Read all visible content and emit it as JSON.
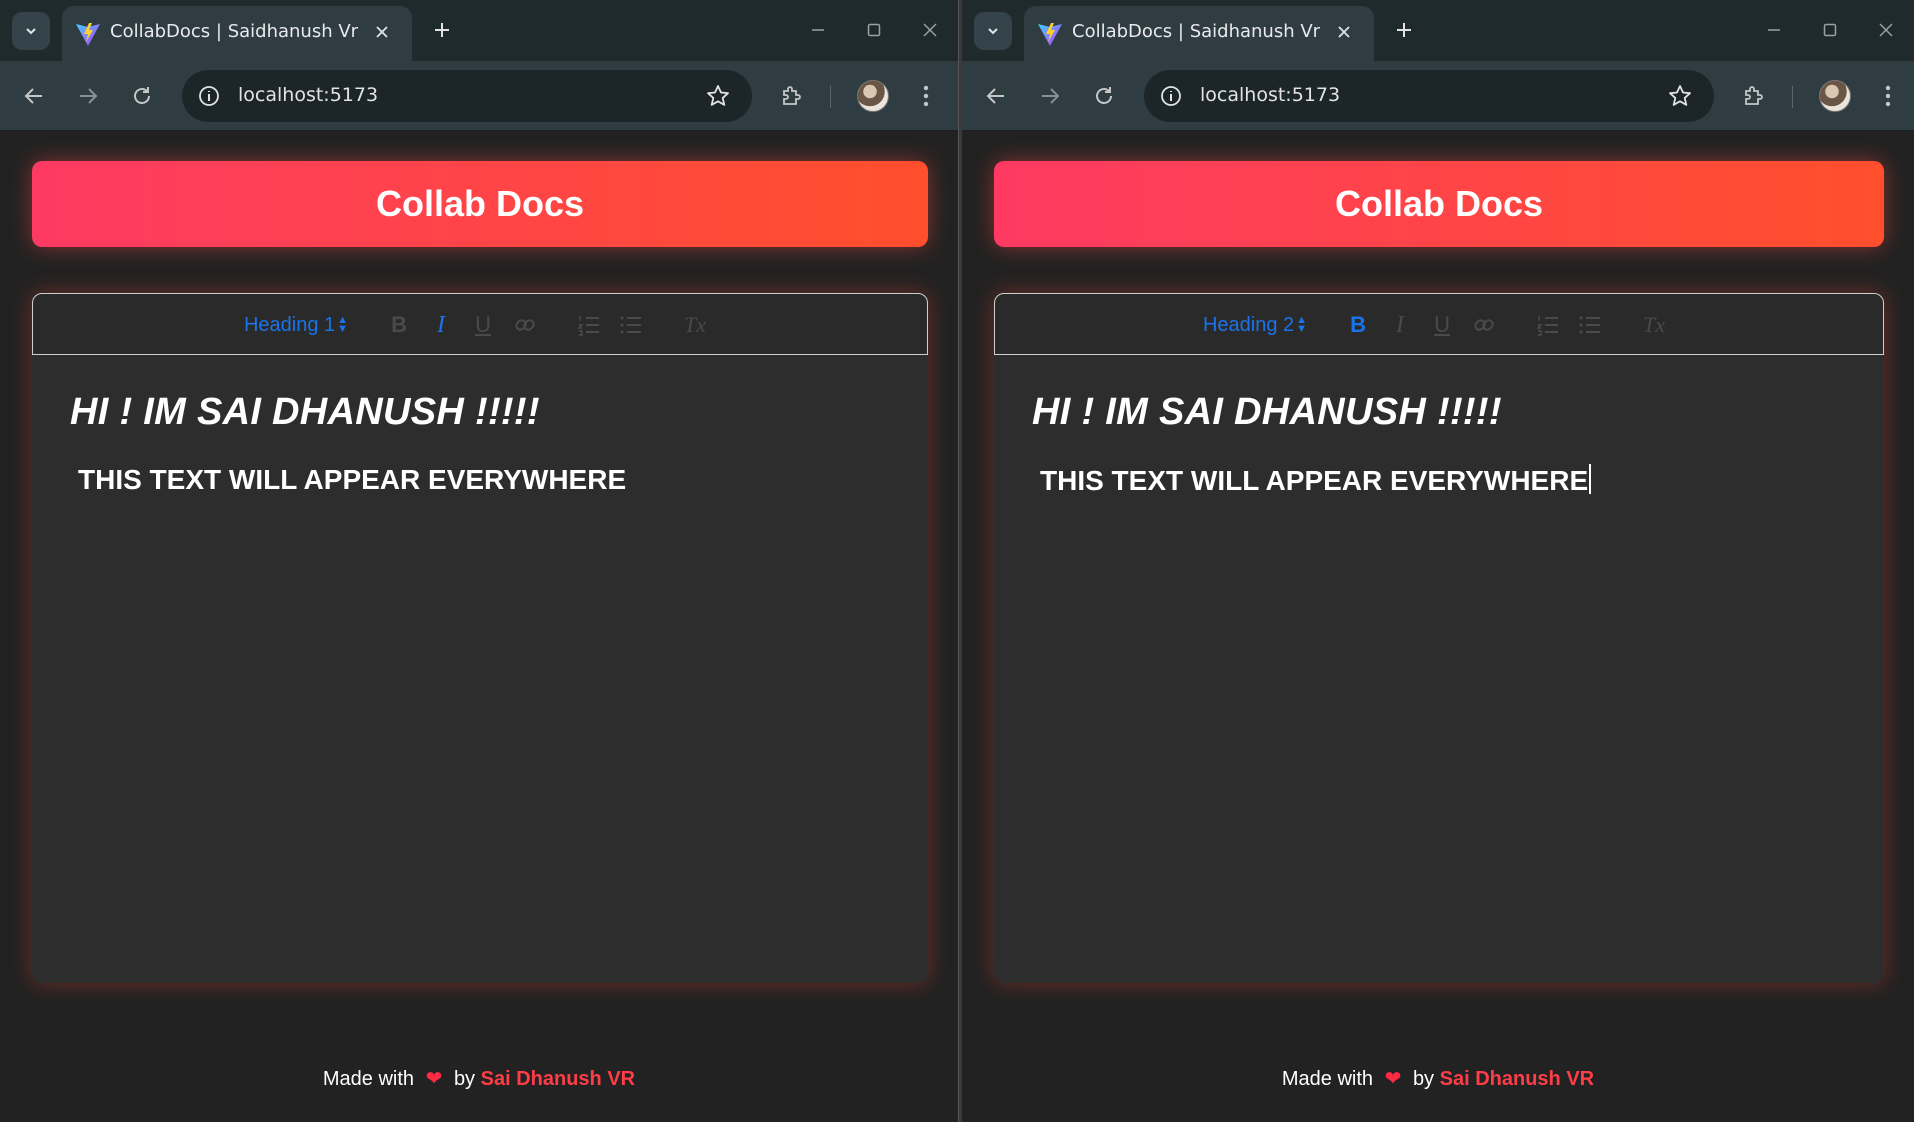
{
  "windows": [
    {
      "tab_title": "CollabDocs | Saidhanush Vr",
      "url": "localhost:5173",
      "app_title": "Collab Docs",
      "toolbar": {
        "heading_picker": "Heading 1",
        "bold": "B",
        "italic": "I",
        "underline": "U",
        "clean": "Tx",
        "active_format": "italic"
      },
      "content": {
        "heading": "HI ! IM SAI DHANUSH !!!!!",
        "line": "THIS TEXT WILL APPEAR EVERYWHERE"
      },
      "footer": {
        "made_with": "Made with",
        "by": "by",
        "author": "Sai Dhanush VR"
      }
    },
    {
      "tab_title": "CollabDocs | Saidhanush Vr",
      "url": "localhost:5173",
      "app_title": "Collab Docs",
      "toolbar": {
        "heading_picker": "Heading 2",
        "bold": "B",
        "italic": "I",
        "underline": "U",
        "clean": "Tx",
        "active_format": "bold"
      },
      "content": {
        "heading": "HI ! IM SAI DHANUSH !!!!!",
        "line": "THIS TEXT WILL APPEAR EVERYWHERE"
      },
      "footer": {
        "made_with": "Made with",
        "by": "by",
        "author": "Sai Dhanush VR"
      }
    }
  ],
  "colors": {
    "accent_start": "#ff3a63",
    "accent_end": "#ff4f2c",
    "quill_active": "#1a73e8",
    "author": "#ff3d47"
  }
}
